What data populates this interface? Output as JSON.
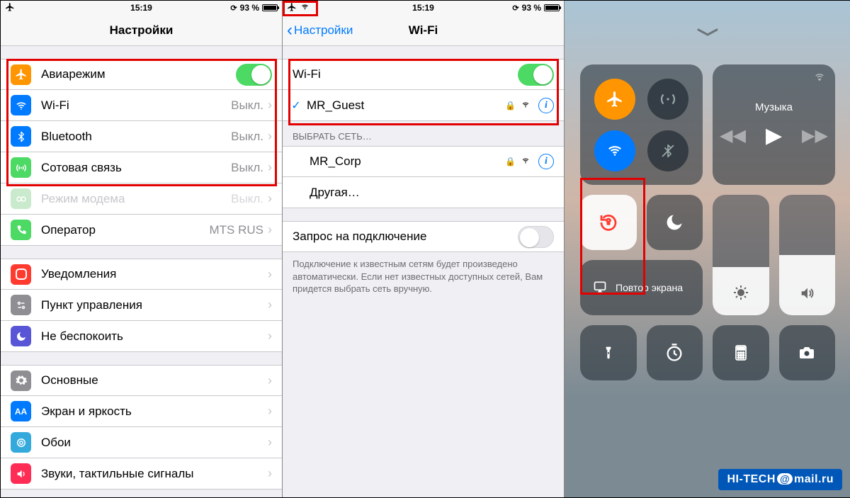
{
  "status": {
    "time": "15:19",
    "battery_pct": "93 %"
  },
  "col1": {
    "title": "Настройки",
    "rows_net": [
      {
        "icon": "plane",
        "bg": "#ff9500",
        "label": "Авиарежим",
        "toggle": true
      },
      {
        "icon": "wifi",
        "bg": "#007aff",
        "label": "Wi-Fi",
        "value": "Выкл."
      },
      {
        "icon": "bt",
        "bg": "#007aff",
        "label": "Bluetooth",
        "value": "Выкл."
      },
      {
        "icon": "cell",
        "bg": "#4cd964",
        "label": "Сотовая связь",
        "value": "Выкл."
      },
      {
        "icon": "hotspot",
        "bg": "#4cd964",
        "label": "Режим модема",
        "value": "Выкл.",
        "disabled": true
      },
      {
        "icon": "carrier",
        "bg": "#4cd964",
        "label": "Оператор",
        "value": "MTS RUS"
      }
    ],
    "rows_sys": [
      {
        "icon": "notif",
        "bg": "#ff3b30",
        "label": "Уведомления"
      },
      {
        "icon": "cc",
        "bg": "#8e8e93",
        "label": "Пункт управления"
      },
      {
        "icon": "dnd",
        "bg": "#5856d6",
        "label": "Не беспокоить"
      }
    ],
    "rows_gen": [
      {
        "icon": "gear",
        "bg": "#8e8e93",
        "label": "Основные"
      },
      {
        "icon": "disp",
        "bg": "#007aff",
        "label": "Экран и яркость"
      },
      {
        "icon": "wall",
        "bg": "#34aadc",
        "label": "Обои"
      },
      {
        "icon": "sound",
        "bg": "#ff2d55",
        "label": "Звуки, тактильные сигналы"
      }
    ]
  },
  "col2": {
    "back": "Настройки",
    "title": "Wi-Fi",
    "wifi_label": "Wi-Fi",
    "connected": "MR_Guest",
    "choose_header": "ВЫБРАТЬ СЕТЬ…",
    "networks": [
      {
        "name": "MR_Corp",
        "secure": true
      },
      {
        "name": "Другая…",
        "secure": false,
        "other": true
      }
    ],
    "ask_label": "Запрос на подключение",
    "ask_footer": "Подключение к известным сетям будет произведено автоматически. Если нет известных доступных сетей, Вам придется выбрать сеть вручную."
  },
  "cc": {
    "music_title": "Музыка",
    "mirror": "Повтор экрана"
  },
  "watermark": {
    "brand": "HI-TECH",
    "domain": "mail",
    "tld": ".ru"
  }
}
